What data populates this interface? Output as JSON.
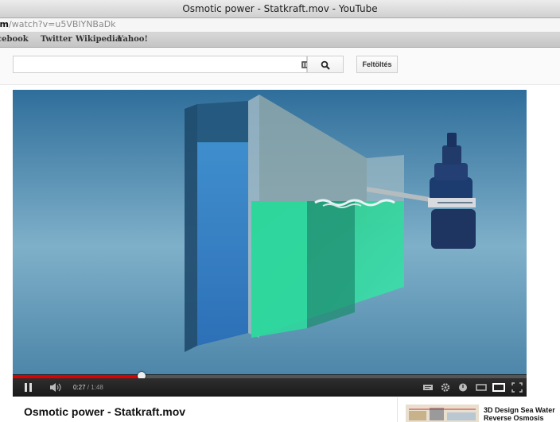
{
  "window": {
    "title": "Osmotic power - Statkraft.mov - YouTube"
  },
  "url": {
    "host_fragment": "om",
    "path": "/watch?v=u5VBlYNBaDk"
  },
  "bookmarks": [
    "cebook",
    "Twitter",
    "Wikipedia",
    "Yahoo!"
  ],
  "search": {
    "value": "",
    "placeholder": "",
    "button_icon": "magnifier",
    "keyboard_icon": "keyboard"
  },
  "header": {
    "upload_label": "Feltöltés"
  },
  "player": {
    "current_time": "0:27",
    "total_time": "1:48",
    "progress_fraction": 0.25,
    "accent_color": "#dd0000",
    "control_icons": [
      "pause-icon",
      "volume-icon",
      "captions-icon",
      "settings-icon",
      "watch-later-icon",
      "small-player-icon",
      "large-player-icon",
      "fullscreen-icon"
    ]
  },
  "video": {
    "title": "Osmotic power - Statkraft.mov"
  },
  "sidebar": {
    "items": [
      {
        "title_line1": "3D Design Sea Water",
        "title_line2": "Reverse Osmosis"
      }
    ]
  }
}
